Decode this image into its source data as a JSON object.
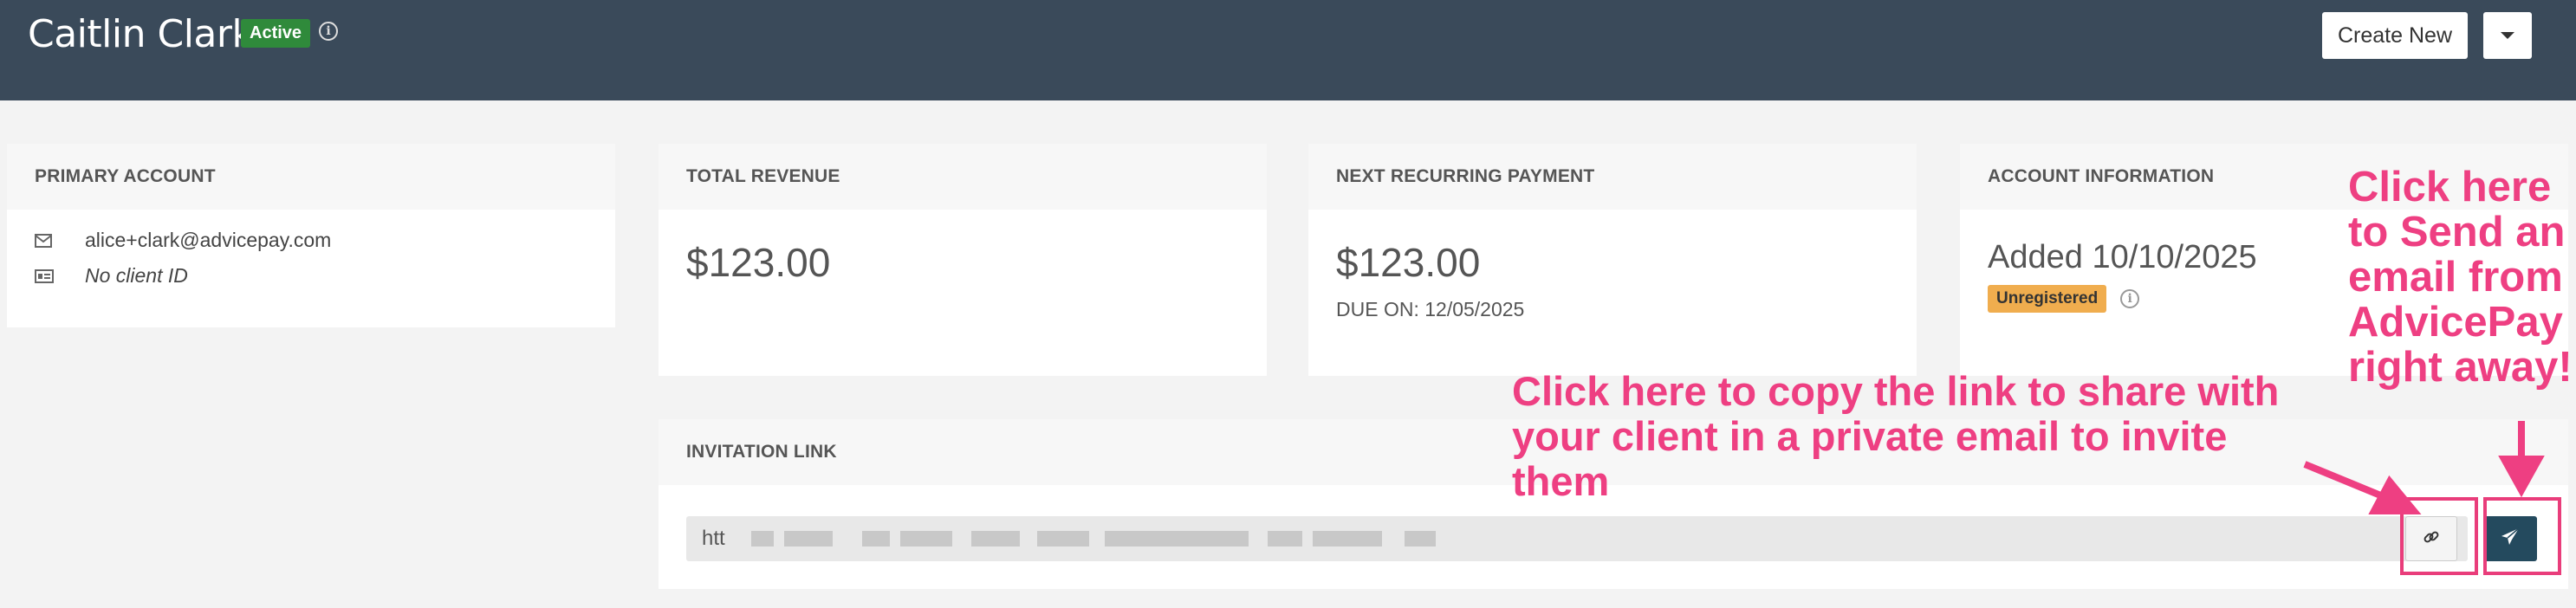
{
  "header": {
    "client_name": "Caitlin Clark",
    "status_badge": "Active",
    "create_new_label": "Create New"
  },
  "cards": {
    "primary_account": {
      "title": "PRIMARY ACCOUNT",
      "email": "alice+clark@advicepay.com",
      "client_id": "No client ID"
    },
    "total_revenue": {
      "title": "TOTAL REVENUE",
      "amount": "$123.00"
    },
    "next_payment": {
      "title": "NEXT RECURRING PAYMENT",
      "amount": "$123.00",
      "due": "DUE ON: 12/05/2025"
    },
    "account_info": {
      "title": "ACCOUNT INFORMATION",
      "added": "Added 10/10/2025",
      "status_badge": "Unregistered"
    },
    "invitation": {
      "title": "INVITATION LINK",
      "link_prefix": "htt"
    }
  },
  "annotations": {
    "copy_hint": "Click here to copy the link to share with your client in a private email to invite them",
    "send_hint": "Click here to Send an email from AdvicePay right away!"
  },
  "colors": {
    "header_bg": "#3a4a5a",
    "active_badge": "#2f8a3b",
    "unregistered_badge": "#f0ad4e",
    "send_button": "#244a5e",
    "annotation": "#ee3f82"
  },
  "icons": {
    "email": "envelope-icon",
    "client_id": "id-card-icon",
    "info": "info-circle-icon",
    "copy": "link-icon",
    "send": "paper-plane-icon"
  }
}
